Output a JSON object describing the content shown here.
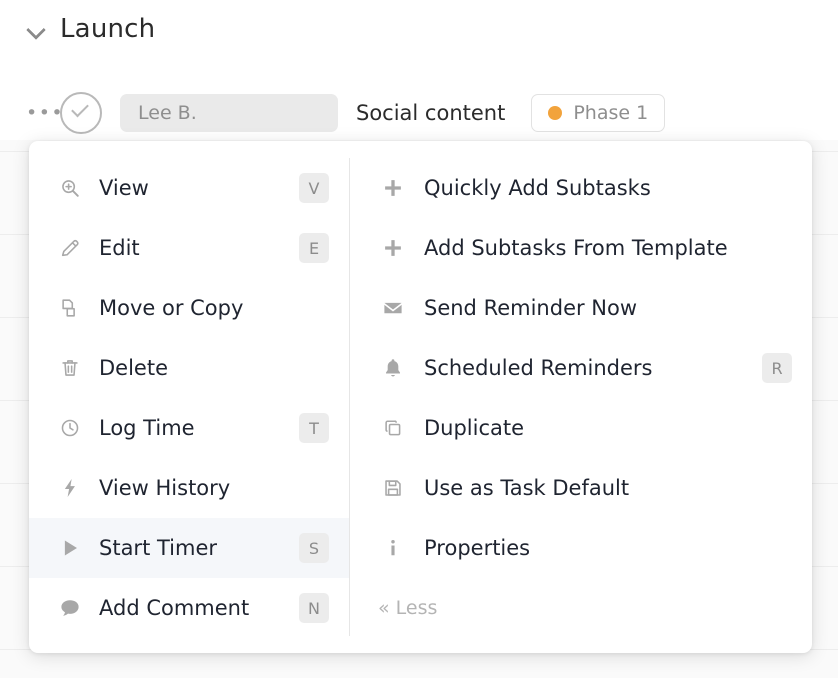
{
  "group": {
    "title": "Launch",
    "collapse_icon": "chevron-down-icon"
  },
  "task": {
    "more_options": "•••",
    "status_icon": "check-circle-icon",
    "assignee": "Lee B.",
    "name": "Social content",
    "phase": {
      "label": "Phase 1",
      "dot_color": "#f2a33c"
    }
  },
  "menu": {
    "left_items": [
      {
        "icon": "zoom-in-icon",
        "label": "View",
        "shortcut": "V",
        "highlighted": false
      },
      {
        "icon": "pencil-icon",
        "label": "Edit",
        "shortcut": "E",
        "highlighted": false
      },
      {
        "icon": "copy-pages-icon",
        "label": "Move or Copy",
        "shortcut": "",
        "highlighted": false
      },
      {
        "icon": "trash-icon",
        "label": "Delete",
        "shortcut": "",
        "highlighted": false
      },
      {
        "icon": "clock-icon",
        "label": "Log Time",
        "shortcut": "T",
        "highlighted": false
      },
      {
        "icon": "bolt-icon",
        "label": "View History",
        "shortcut": "",
        "highlighted": false
      },
      {
        "icon": "play-icon",
        "label": "Start Timer",
        "shortcut": "S",
        "highlighted": true
      },
      {
        "icon": "comment-icon",
        "label": "Add Comment",
        "shortcut": "N",
        "highlighted": false
      }
    ],
    "right_items": [
      {
        "icon": "plus-icon",
        "label": "Quickly Add Subtasks",
        "shortcut": "",
        "highlighted": false
      },
      {
        "icon": "plus-icon",
        "label": "Add Subtasks From Template",
        "shortcut": "",
        "highlighted": false
      },
      {
        "icon": "envelope-icon",
        "label": "Send Reminder Now",
        "shortcut": "",
        "highlighted": false
      },
      {
        "icon": "bell-icon",
        "label": "Scheduled Reminders",
        "shortcut": "R",
        "highlighted": false
      },
      {
        "icon": "duplicate-icon",
        "label": "Duplicate",
        "shortcut": "",
        "highlighted": false
      },
      {
        "icon": "floppy-disk-icon",
        "label": "Use as Task Default",
        "shortcut": "",
        "highlighted": false
      },
      {
        "icon": "info-icon",
        "label": "Properties",
        "shortcut": "",
        "highlighted": false
      }
    ],
    "less_label": "« Less"
  },
  "colors": {
    "highlight_row": "#f5f7fa",
    "shortcut_badge": "#ececec",
    "phase_dot": "#f2a33c",
    "text_primary": "#1f2430",
    "text_muted": "#8e8e8e"
  }
}
